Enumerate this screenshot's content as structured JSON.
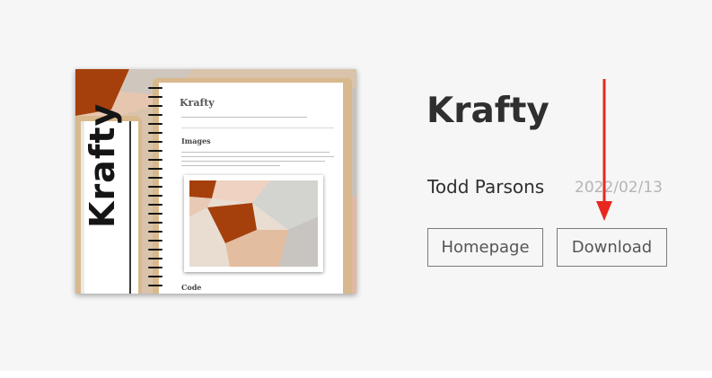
{
  "theme": {
    "name": "Krafty",
    "author": "Todd Parsons",
    "date": "2022/02/13",
    "thumbnail": {
      "cover_text": "Krafty",
      "notebook_title": "Krafty",
      "sections": [
        "Images",
        "Code"
      ]
    }
  },
  "actions": {
    "homepage_label": "Homepage",
    "download_label": "Download"
  },
  "colors": {
    "background": "#f6f6f6",
    "text": "#2f2f2f",
    "muted": "#b5b5b5",
    "annotation_arrow": "#e8281e"
  }
}
